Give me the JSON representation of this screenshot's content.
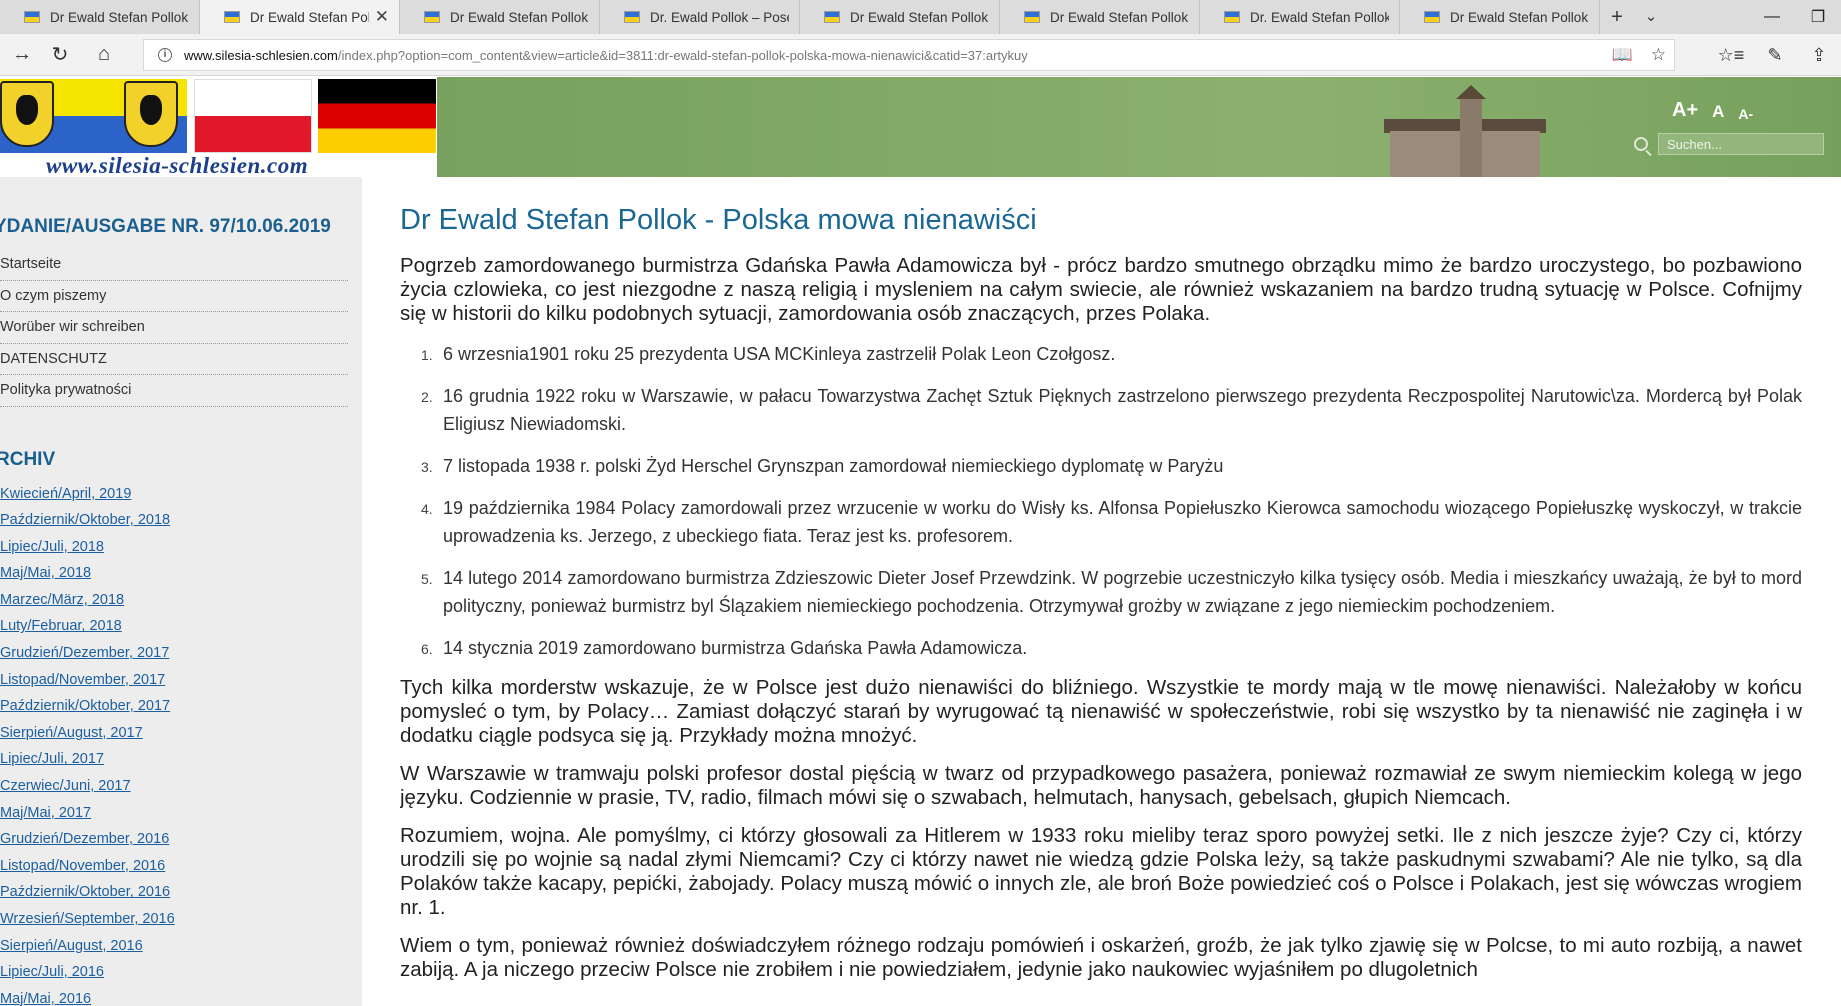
{
  "browser": {
    "tabs": [
      {
        "title": "Dr Ewald Stefan Pollok - Kos",
        "active": false
      },
      {
        "title": "Dr Ewald Stefan Pollok -",
        "active": true
      },
      {
        "title": "Dr Ewald Stefan Pollok - Os",
        "active": false
      },
      {
        "title": "Dr. Ewald Pollok – Poseł Kry",
        "active": false
      },
      {
        "title": "Dr Ewald Stefan Pollok - Czy",
        "active": false
      },
      {
        "title": "Dr Ewald Stefan Pollok – Jak",
        "active": false
      },
      {
        "title": "Dr. Ewald Stefan Pollok - Po",
        "active": false
      },
      {
        "title": "Dr Ewald Stefan Pollok - Oś",
        "active": false
      }
    ],
    "url_domain": "www.silesia-schlesien.com",
    "url_path": "/index.php?option=com_content&view=article&id=3811:dr-ewald-stefan-pollok-polska-mowa-nienawici&catid=37:artykuy",
    "icons": [
      "back-icon",
      "forward-icon",
      "refresh-icon",
      "home-icon",
      "info-icon",
      "reading-view-icon",
      "favorite-star-icon",
      "favorites-hub-icon",
      "pen-icon",
      "share-icon"
    ]
  },
  "banner": {
    "site_url": "www.silesia-schlesien.com",
    "font_size_controls": [
      "A+",
      "A",
      "A-"
    ],
    "search_placeholder": "Suchen..."
  },
  "sidebar": {
    "edition_heading": "YDANIE/AUSGABE NR. 97/10.06.2019",
    "menu": [
      "Startseite",
      "O czym piszemy",
      "Worüber wir schreiben",
      "DATENSCHUTZ",
      "Polityka prywatności"
    ],
    "archive_heading": "RCHIV",
    "archive": [
      "Kwiecień/April, 2019",
      "Październik/Oktober, 2018",
      "Lipiec/Juli, 2018",
      "Maj/Mai, 2018",
      "Marzec/März, 2018",
      "Luty/Februar, 2018",
      "Grudzień/Dezember, 2017",
      "Listopad/November, 2017",
      "Październik/Oktober, 2017",
      "Sierpień/August, 2017",
      "Lipiec/Juli, 2017",
      "Czerwiec/Juni, 2017",
      "Maj/Mai, 2017",
      "Grudzień/Dezember, 2016",
      "Listopad/November, 2016",
      "Październik/Oktober, 2016",
      "Wrzesień/September, 2016",
      "Sierpień/August, 2016",
      "Lipiec/Juli, 2016",
      "Maj/Mai, 2016"
    ]
  },
  "article": {
    "title": "Dr Ewald Stefan Pollok - Polska mowa nienawiści",
    "intro": "Pogrzeb zamordowanego burmistrza Gdańska Pawła Adamowicza był - prócz bardzo smutnego obrządku mimo że bardzo uroczystego, bo pozbawiono życia czlowieka, co jest niezgodne z naszą religią i mysleniem na całym swiecie, ale również wskazaniem na bardzo trudną sytuację w Polsce. Cofnijmy się w historii do kilku podobnych sytuacji, zamordowania osób znaczących, przes Polaka.",
    "list": [
      "6 wrzesnia1901 roku 25 prezydenta USA MCKinleya zastrzelił Polak Leon Czołgosz.",
      "16 grudnia 1922 roku w Warszawie, w pałacu Towarzystwa Zachęt Sztuk Pięknych zastrzelono pierwszego prezydenta Reczpospolitej Narutowic\\za. Mordercą był Polak Eligiusz Niewiadomski.",
      "7 listopada 1938 r. polski Żyd Herschel Grynszpan zamordował niemieckiego dyplomatę w Paryżu",
      "19 października 1984 Polacy zamordowali przez wrzucenie w worku do Wisły ks. Alfonsa Popiełuszko Kierowca samochodu wiozącego Popiełuszkę wyskoczył, w trakcie uprowadzenia ks. Jerzego, z ubeckiego fiata. Teraz jest ks. profesorem.",
      "14 lutego 2014 zamordowano burmistrza Zdzieszowic Dieter Josef Przewdzink. W pogrzebie uczestniczyło kilka tysięcy osób. Media i mieszkańcy uważają, że był to mord polityczny, ponieważ burmistrz byl Ślązakiem niemieckiego pochodzenia. Otrzymywał grożby w związane z jego niemieckim pochodzeniem.",
      "14 stycznia 2019 zamordowano burmistrza Gdańska Pawła Adamowicza."
    ],
    "paragraphs": [
      "Tych kilka morderstw wskazuje, że w Polsce jest dużo nienawiści do bliźniego. Wszystkie te mordy mają w tle mowę nienawiści. Należałoby w końcu pomysleć o tym, by Polacy… Zamiast dołączyć starań by wyrugować tą nienawiść w społeczeństwie, robi się wszystko by ta nienawiść nie zaginęła i w dodatku ciągle podsyca się ją. Przykłady można mnożyć.",
      "W Warszawie w tramwaju polski profesor dostal pięścią w twarz od przypadkowego pasażera, ponieważ rozmawiał ze swym niemieckim kolegą w jego języku. Codziennie w prasie, TV, radio, filmach mówi się o szwabach, helmutach, hanysach, gebelsach, głupich Niemcach.",
      "Rozumiem, wojna. Ale pomyślmy, ci którzy głosowali za Hitlerem w 1933 roku mieliby teraz sporo powyżej setki. Ile z nich jeszcze żyje? Czy ci, którzy urodzili się po wojnie są nadal złymi Niemcami? Czy ci którzy nawet nie wiedzą gdzie Polska leży, są także paskudnymi szwabami? Ale nie tylko, są dla Polaków także kacapy, pepićki, żabojady. Polacy muszą mówić o innych zle, ale broń Boże powiedzieć coś o Polsce i Polakach, jest się wówczas wrogiem nr. 1.",
      "Wiem o tym, ponieważ również doświadczyłem różnego rodzaju pomówień i oskarżeń, groźb, że jak tylko zjawię się w Polcse, to mi auto rozbiją, a nawet zabiją. A ja niczego przeciw Polsce nie zrobiłem i nie powiedziałem, jedynie jako naukowiec wyjaśniłem po dlugoletnich"
    ]
  }
}
